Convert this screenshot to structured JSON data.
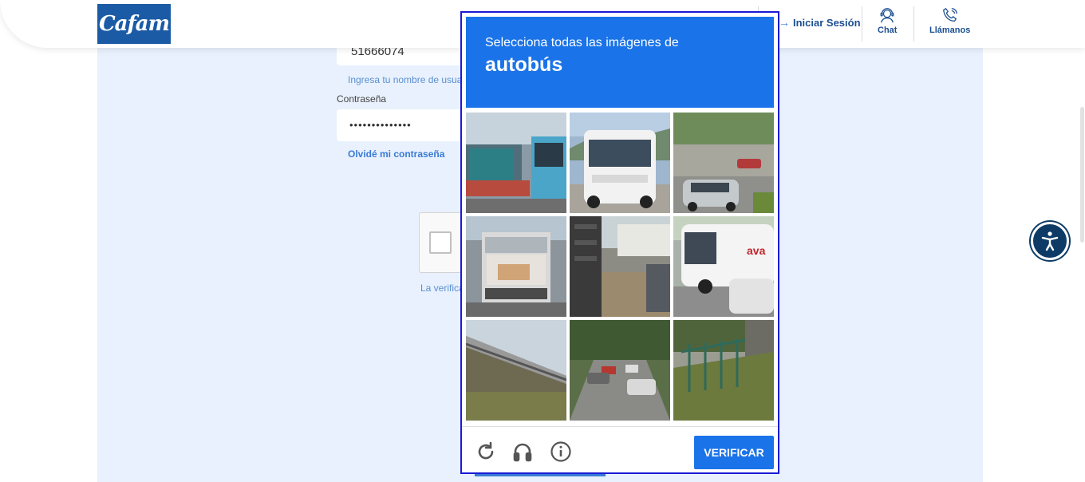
{
  "header": {
    "logo_text": "Cafam",
    "login_label": "Iniciar Sesión",
    "chat_label": "Chat",
    "call_label": "Llámanos"
  },
  "form": {
    "username_value": "51666074",
    "username_hint": "Ingresa tu nombre de usua",
    "password_label": "Contraseña",
    "password_value": "••••••••••••••",
    "forgot_label": "Olvidé mi contraseña",
    "verification_text": "La verifica"
  },
  "captcha": {
    "instruction": "Selecciona todas las imágenes de",
    "target": "autobús",
    "verify_label": "VERIFICAR",
    "tiles": [
      "bus-stop-blue-bus",
      "white-minibus-front",
      "cars-on-road",
      "truck-rear",
      "trailer-ramp",
      "white-bus-side",
      "bridge-railing",
      "street-with-cars",
      "sidewalk-fence"
    ]
  },
  "icons": {
    "reload": "reload-icon",
    "audio": "headphones-icon",
    "info": "info-icon",
    "accessibility": "accessibility-icon"
  },
  "colors": {
    "captcha_blue": "#1a73e8",
    "brand_blue": "#1b5ba6",
    "page_bg": "#e8f1fd"
  }
}
